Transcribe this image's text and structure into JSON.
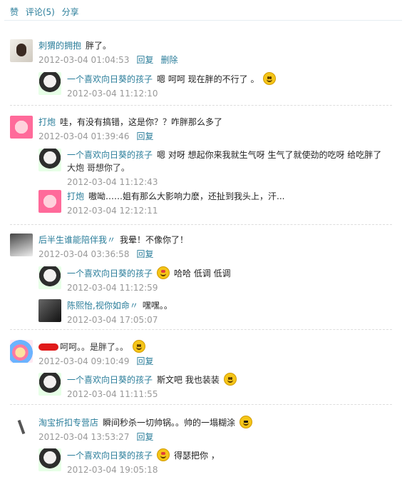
{
  "top": {
    "like": "赞",
    "comment": "评论(5)",
    "share": "分享"
  },
  "actions": {
    "reply": "回复",
    "delete": "删除"
  },
  "threads": [
    {
      "name": "刺猬的拥抱",
      "text": "胖了。",
      "time": "2012-03-04 01:04:53",
      "deletable": true,
      "replies": [
        {
          "name": "一个喜欢向日葵的孩子",
          "text": "嗯 呵呵 现在胖的不行了 。",
          "time": "2012-03-04 11:12:10",
          "emoji": "blush-emoji-icon"
        }
      ]
    },
    {
      "name": "打炮",
      "text": "哇，有没有搞错，这是你？？咋胖那么多了",
      "time": "2012-03-04 01:39:46",
      "replies": [
        {
          "name": "一个喜欢向日葵的孩子",
          "text": "嗯 对呀 想起你来我就生气呀 生气了就使劲的吃呀 给吃胖了",
          "text2": "大炮 哥想你了。",
          "time": "2012-03-04 11:12:43"
        },
        {
          "name": "打炮",
          "text": "嗷呦……姐有那么大影响力麽，还扯到我头上，汗...",
          "time": "2012-03-04 12:12:11"
        }
      ]
    },
    {
      "name": "后半生谁能陪伴我〃",
      "text": "我晕！不像你了！",
      "time": "2012-03-04 03:36:58",
      "replies": [
        {
          "name": "一个喜欢向日葵的孩子",
          "emoji_before": "heart-eyes-emoji-icon",
          "text": "哈哈 低调 低调",
          "time": "2012-03-04 11:12:59"
        },
        {
          "name": "陈熙怡,视你如命〃",
          "text": "嘿嘿。。",
          "time": "2012-03-04 17:05:07"
        }
      ]
    },
    {
      "name": "",
      "text": "呵呵。。是胖了。。",
      "time": "2012-03-04 09:10:49",
      "emoji": "grin-emoji-icon",
      "replies": [
        {
          "name": "一个喜欢向日葵的孩子",
          "text": "斯文吧 我也装装",
          "time": "2012-03-04 11:11:55",
          "emoji": "smile-emoji-icon"
        }
      ]
    },
    {
      "name": "淘宝折扣专营店",
      "text": "瞬间秒杀一切帅锅。。帅的一塌糊涂",
      "time": "2012-03-04 13:53:27",
      "emoji": "cool-emoji-icon",
      "replies": [
        {
          "name": "一个喜欢向日葵的孩子",
          "emoji_before": "heart-eyes-emoji-icon",
          "text": "得瑟把你 ，",
          "time": "2012-03-04 19:05:18"
        }
      ]
    }
  ]
}
